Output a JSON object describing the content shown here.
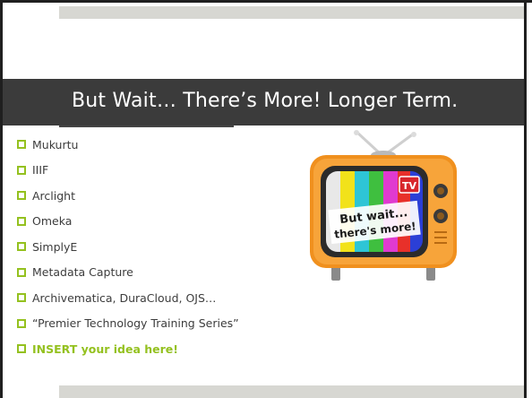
{
  "slide": {
    "title": "But Wait… There’s More! Longer Term.",
    "bullets": [
      "Mukurtu",
      "IIIF",
      "Arclight",
      "Omeka",
      "SimplyE",
      "Metadata Capture",
      "Archivematica, DuraCloud, OJS…",
      "“Premier Technology Training Series”",
      "INSERT your idea here!"
    ],
    "tv_image": {
      "badge_text": "TV",
      "screen_text_line1": "But wait...",
      "screen_text_line2": "there's more!"
    }
  },
  "colors": {
    "accent": "#94c11f",
    "title_bar": "#3b3b3b",
    "text": "#3c3c3c",
    "band": "#d7d7d2"
  }
}
